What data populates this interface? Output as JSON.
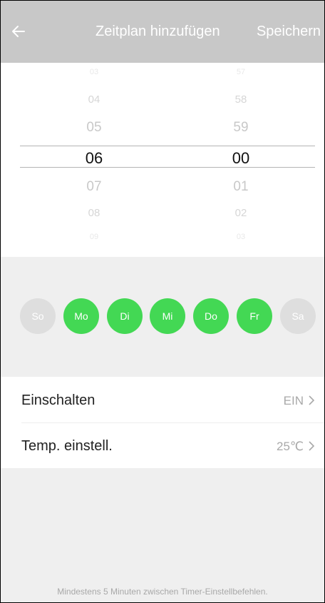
{
  "header": {
    "title": "Zeitplan hinzufügen",
    "save_label": "Speichern",
    "back_icon": "arrow-left-icon"
  },
  "picker": {
    "hours": [
      "03",
      "04",
      "05",
      "06",
      "07",
      "08",
      "09"
    ],
    "minutes": [
      "57",
      "58",
      "59",
      "00",
      "01",
      "02",
      "03"
    ],
    "selected_hour": "06",
    "selected_minute": "00"
  },
  "days": [
    {
      "label": "So",
      "active": false
    },
    {
      "label": "Mo",
      "active": true
    },
    {
      "label": "Di",
      "active": true
    },
    {
      "label": "Mi",
      "active": true
    },
    {
      "label": "Do",
      "active": true
    },
    {
      "label": "Fr",
      "active": true
    },
    {
      "label": "Sa",
      "active": false
    }
  ],
  "settings": [
    {
      "label": "Einschalten",
      "value": "EIN"
    },
    {
      "label": "Temp. einstell.",
      "value": "25℃"
    }
  ],
  "footer_note": "Mindestens 5 Minuten zwischen Timer-Einstellbefehlen.",
  "colors": {
    "header_bg": "#c8c8c8",
    "active_day": "#43d854",
    "inactive_day": "#dedede"
  }
}
